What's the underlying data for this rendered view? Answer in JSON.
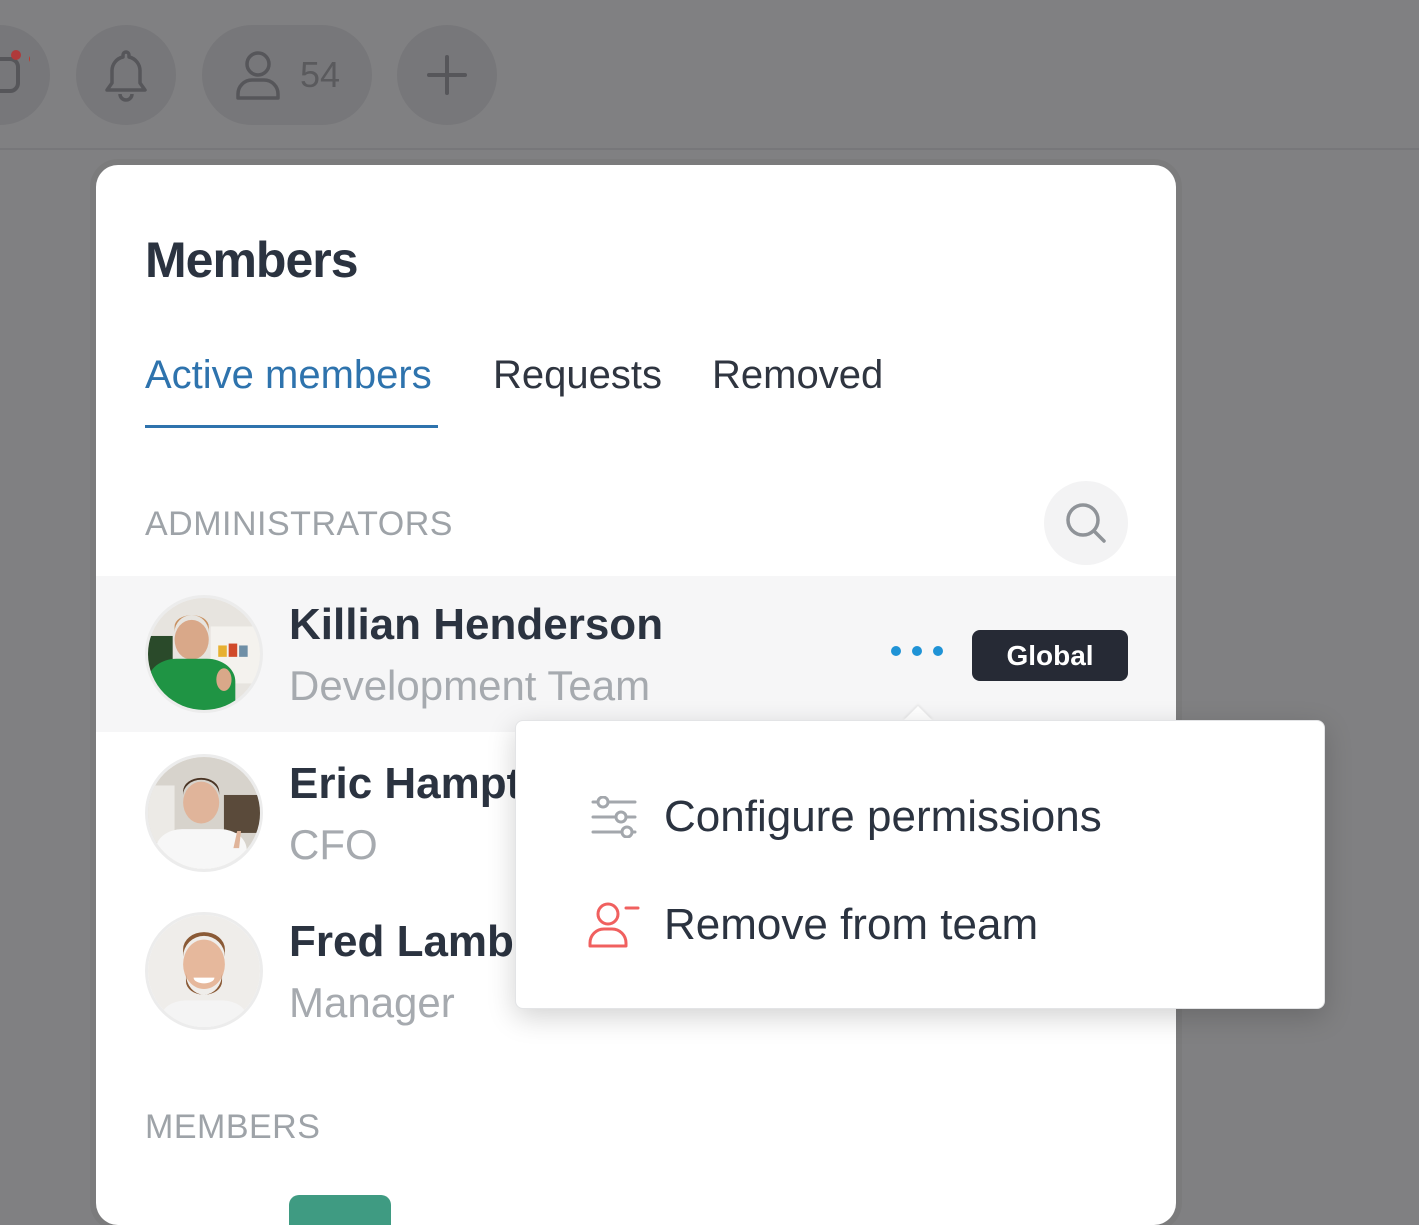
{
  "topbar": {
    "members_count": "54"
  },
  "panel": {
    "title": "Members",
    "tabs": [
      {
        "label": "Active members",
        "active": true
      },
      {
        "label": "Requests",
        "active": false
      },
      {
        "label": "Removed",
        "active": false
      }
    ],
    "sections": {
      "administrators_label": "ADMINISTRATORS",
      "members_label": "MEMBERS"
    },
    "administrators": [
      {
        "name": "Killian Henderson",
        "role": "Development Team",
        "badge": "Global"
      },
      {
        "name": "Eric Hampt",
        "role": "CFO"
      },
      {
        "name": "Fred Lambe",
        "role": "Manager"
      }
    ]
  },
  "menu": {
    "items": [
      {
        "label": "Configure permissions",
        "icon": "sliders-icon"
      },
      {
        "label": "Remove from team",
        "icon": "user-remove-icon"
      }
    ]
  },
  "colors": {
    "accent": "#2e73ad",
    "dots": "#1f93d6",
    "badge_bg": "#262a35",
    "danger": "#f0605f"
  }
}
